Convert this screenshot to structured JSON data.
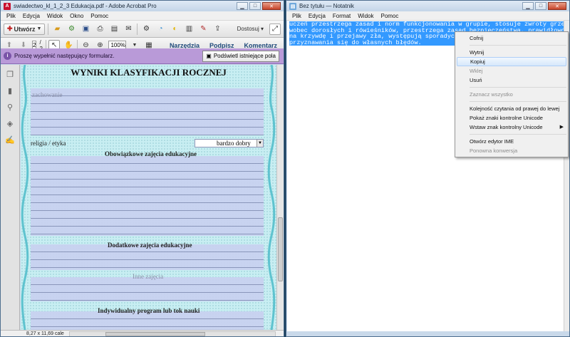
{
  "acrobat": {
    "title": "swiadectwo_kl_1_2_3 Edukacja.pdf - Adobe Acrobat Pro",
    "menu": [
      "Plik",
      "Edycja",
      "Widok",
      "Okno",
      "Pomoc"
    ],
    "toolbar": {
      "create_label": "Utwórz",
      "page_current": "2",
      "page_total": "/ 2",
      "zoom": "100%",
      "customize_label": "Dostosuj"
    },
    "panels": [
      "Narzędzia",
      "Podpisz",
      "Komentarz"
    ],
    "formbar": {
      "message": "Proszę wypełnić następujący formularz.",
      "highlight_label": "Podświetl istniejące pola"
    },
    "document": {
      "heading": "WYNIKI KLASYFIKACJI ROCZNEJ",
      "behavior_label": "zachowanie",
      "religion_label": "religia / etyka",
      "religion_grade": "bardzo dobry",
      "mandatory_label": "Obowiązkowe zajęcia edukacyjne",
      "additional_label": "Dodatkowe zajęcia edukacyjne",
      "other_label": "Inne zajęcia",
      "individual_label": "Indywidualny program lub tok nauki"
    },
    "status": {
      "page_size": "8,27 x 11,69 cale"
    }
  },
  "notepad": {
    "title": "Bez tytułu — Notatnik",
    "menu": [
      "Plik",
      "Edycja",
      "Format",
      "Widok",
      "Pomoc"
    ],
    "text_lines": [
      "uczeń przestrzega zasad i norm funkcjonowania w grupie, stosuje zwroty grzecznościowe",
      "wobec dorosłych i rówieśników, przestrzega zasad bezpieczeństwa, prawidłowo reaguje",
      "na krzywdę i przejawy zła, występują sporadyczne wulgaryzmy",
      "przyznawania się do własnych błędów."
    ]
  },
  "context_menu": {
    "items": [
      {
        "label": "Cofnij",
        "enabled": true,
        "highlighted": false
      },
      {
        "sep": true
      },
      {
        "label": "Wytnij",
        "enabled": true,
        "highlighted": false
      },
      {
        "label": "Kopiuj",
        "enabled": true,
        "highlighted": true
      },
      {
        "label": "Wklej",
        "enabled": false,
        "highlighted": false
      },
      {
        "label": "Usuń",
        "enabled": true,
        "highlighted": false
      },
      {
        "sep": true
      },
      {
        "label": "Zaznacz wszystko",
        "enabled": false,
        "highlighted": false
      },
      {
        "sep": true
      },
      {
        "label": "Kolejność czytania od prawej do lewej",
        "enabled": true,
        "highlighted": false
      },
      {
        "label": "Pokaż znaki kontrolne Unicode",
        "enabled": true,
        "highlighted": false
      },
      {
        "label": "Wstaw znak kontrolny Unicode",
        "enabled": true,
        "highlighted": false,
        "submenu": true
      },
      {
        "sep": true
      },
      {
        "label": "Otwórz edytor IME",
        "enabled": true,
        "highlighted": false
      },
      {
        "label": "Ponowna konwersja",
        "enabled": false,
        "highlighted": false
      }
    ],
    "submenu_arrow": "▶"
  }
}
